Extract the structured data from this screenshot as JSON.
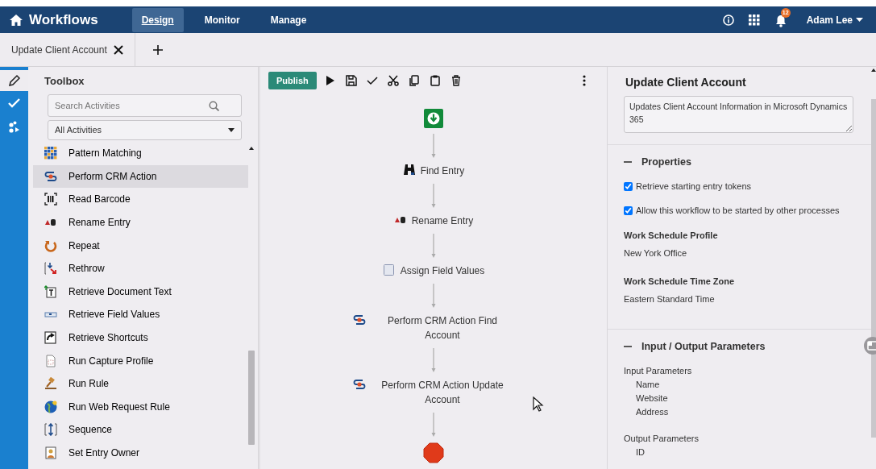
{
  "app": {
    "title": "Workflows"
  },
  "nav_tabs": [
    {
      "label": "Design",
      "selected": true
    },
    {
      "label": "Monitor",
      "selected": false
    },
    {
      "label": "Manage",
      "selected": false
    }
  ],
  "notifications": {
    "count": "12"
  },
  "user": {
    "name": "Adam Lee"
  },
  "doc_tabs": [
    {
      "label": "Update Client Account"
    }
  ],
  "rail": [
    {
      "kind": "design",
      "selected": true
    },
    {
      "kind": "validate",
      "selected": false
    },
    {
      "kind": "hierarchy",
      "selected": false
    }
  ],
  "toolbox": {
    "title": "Toolbox",
    "search": {
      "placeholder": "Search Activities"
    },
    "filter": "All Activities",
    "items": [
      {
        "label": "Pattern Matching",
        "kind": "grid",
        "selected": false
      },
      {
        "label": "Perform CRM Action",
        "kind": "crm",
        "selected": true
      },
      {
        "label": "Read Barcode",
        "kind": "barcode",
        "selected": false
      },
      {
        "label": "Rename Entry",
        "kind": "rename",
        "selected": false
      },
      {
        "label": "Repeat",
        "kind": "repeat",
        "selected": false
      },
      {
        "label": "Rethrow",
        "kind": "rethrow",
        "selected": false
      },
      {
        "label": "Retrieve Document Text",
        "kind": "doctext",
        "selected": false
      },
      {
        "label": "Retrieve Field Values",
        "kind": "fields",
        "selected": false
      },
      {
        "label": "Retrieve Shortcuts",
        "kind": "shortcut",
        "selected": false
      },
      {
        "label": "Run Capture Profile",
        "kind": "capture",
        "selected": false
      },
      {
        "label": "Run Rule",
        "kind": "gavel",
        "selected": false
      },
      {
        "label": "Run Web Request Rule",
        "kind": "globe",
        "selected": false
      },
      {
        "label": "Sequence",
        "kind": "sequence",
        "selected": false
      },
      {
        "label": "Set Entry Owner",
        "kind": "owner",
        "selected": false
      }
    ]
  },
  "toolbar": {
    "publish": "Publish"
  },
  "flow": [
    {
      "kind": "start"
    },
    {
      "kind": "find",
      "label": "Find Entry"
    },
    {
      "kind": "rename",
      "label": "Rename Entry"
    },
    {
      "kind": "assign",
      "label": "Assign Field Values"
    },
    {
      "kind": "crm",
      "label": "Perform CRM Action Find Account"
    },
    {
      "kind": "crm",
      "label": "Perform CRM Action Update Account"
    },
    {
      "kind": "end"
    }
  ],
  "properties_panel": {
    "title": "Update Client Account",
    "description": "Updates Client Account Information in Microsoft Dynamics 365",
    "sections": [
      {
        "title": "Properties",
        "expanded": true,
        "options": [
          {
            "label": "Retrieve starting entry tokens",
            "checked": true
          },
          {
            "label": "Allow this workflow to be started by other processes",
            "checked": true
          }
        ],
        "fields": [
          {
            "label": "Work Schedule Profile",
            "value": "New York Office"
          },
          {
            "label": "Work Schedule Time Zone",
            "value": "Eastern Standard Time"
          }
        ]
      },
      {
        "title": "Input / Output Parameters",
        "expanded": true,
        "groups": [
          {
            "label": "Input Parameters",
            "items": [
              "Name",
              "Website",
              "Address"
            ]
          },
          {
            "label": "Output Parameters",
            "items": [
              "ID"
            ]
          }
        ]
      }
    ]
  }
}
